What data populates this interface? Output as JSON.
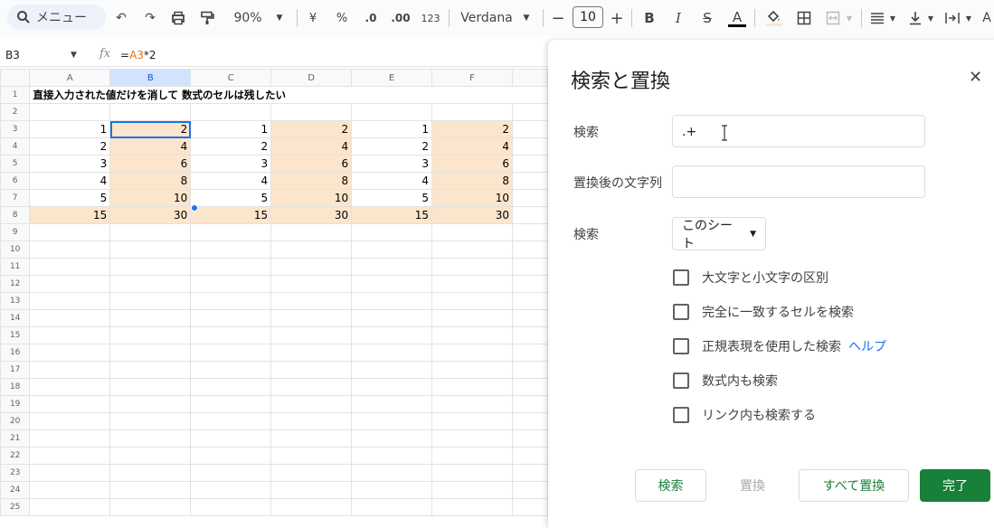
{
  "toolbar": {
    "menu_search": "メニュー",
    "zoom": "90%",
    "currency": "¥",
    "percent": "%",
    "decrease_decimal": ".0",
    "increase_decimal": ".00",
    "number_format": "123",
    "font": "Verdana",
    "font_size": "10",
    "bold": "B",
    "italic": "I",
    "strike": "S",
    "text_color": "A"
  },
  "formula_bar": {
    "cell_ref": "B3",
    "fx": "fx",
    "formula_prefix": "=",
    "formula_ref": "A3",
    "formula_suffix": "*2"
  },
  "sheet": {
    "columns": [
      "A",
      "B",
      "C",
      "D",
      "E",
      "F"
    ],
    "selected_column": "B",
    "title": "直接入力された値だけを消して 数式のセルは残したい",
    "row_numbers": [
      "1",
      "2",
      "3",
      "4",
      "5",
      "6",
      "7",
      "8",
      "9",
      "10",
      "11",
      "12",
      "13",
      "14",
      "15",
      "16",
      "17",
      "18",
      "19",
      "20",
      "21",
      "22",
      "23",
      "24",
      "25"
    ],
    "data": [
      [
        "1",
        "2",
        "1",
        "2",
        "1",
        "2"
      ],
      [
        "2",
        "4",
        "2",
        "4",
        "2",
        "4"
      ],
      [
        "3",
        "6",
        "3",
        "6",
        "3",
        "6"
      ],
      [
        "4",
        "8",
        "4",
        "8",
        "4",
        "8"
      ],
      [
        "5",
        "10",
        "5",
        "10",
        "5",
        "10"
      ],
      [
        "15",
        "30",
        "15",
        "30",
        "15",
        "30"
      ]
    ],
    "peach_color": "#fce5cd"
  },
  "dialog": {
    "title": "検索と置換",
    "find_label": "検索",
    "find_value": ".+",
    "replace_label": "置換後の文字列",
    "replace_value": "",
    "scope_label": "検索",
    "scope_value": "このシート",
    "options": [
      {
        "label": "大文字と小文字の区別",
        "checked": false
      },
      {
        "label": "完全に一致するセルを検索",
        "checked": false
      },
      {
        "label": "正規表現を使用した検索",
        "checked": false,
        "help": "ヘルプ"
      },
      {
        "label": "数式内も検索",
        "checked": false
      },
      {
        "label": "リンク内も検索する",
        "checked": false
      }
    ],
    "buttons": {
      "find": "検索",
      "replace": "置換",
      "replace_all": "すべて置換",
      "done": "完了"
    },
    "accent": "#188038"
  }
}
